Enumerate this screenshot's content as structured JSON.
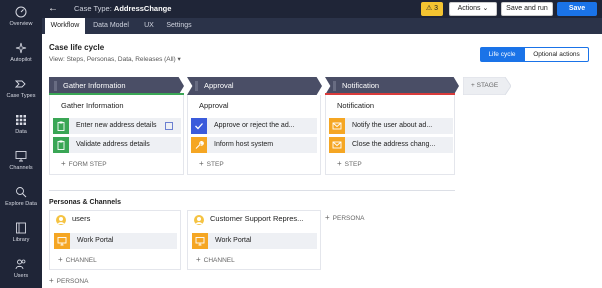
{
  "nav": {
    "items": [
      {
        "label": "Overview",
        "icon": "gauge-icon"
      },
      {
        "label": "Autopilot",
        "icon": "sparkle-icon"
      },
      {
        "label": "Case Types",
        "icon": "chevron-flow-icon"
      },
      {
        "label": "Data",
        "icon": "grid-icon"
      },
      {
        "label": "Channels",
        "icon": "monitor-icon"
      },
      {
        "label": "Explore Data",
        "icon": "explore-icon"
      },
      {
        "label": "Library",
        "icon": "library-icon"
      },
      {
        "label": "Users",
        "icon": "users-icon"
      }
    ]
  },
  "topbar": {
    "case_type_prefix": "Case Type:",
    "case_type_name": "AddressChange",
    "warning_count": "3",
    "actions_label": "Actions",
    "save_and_run_label": "Save and run",
    "save_label": "Save"
  },
  "tabs": [
    {
      "label": "Workflow"
    },
    {
      "label": "Data Model"
    },
    {
      "label": "UX"
    },
    {
      "label": "Settings"
    }
  ],
  "lifecycle": {
    "title": "Case life cycle",
    "view_text": "View: Steps, Personas, Data, Releases (All)",
    "toggle_lifecycle": "Life cycle",
    "toggle_optional": "Optional actions"
  },
  "stages": [
    {
      "name": "Gather Information",
      "accent": "#3aa655",
      "process": "Gather Information",
      "steps": [
        {
          "label": "Enter new address details",
          "icon": "clipboard-icon",
          "color": "#3aa655"
        },
        {
          "label": "Validate address details",
          "icon": "clipboard-icon",
          "color": "#3aa655"
        }
      ],
      "add_label": "FORM STEP"
    },
    {
      "name": "Approval",
      "accent": "#4a4e66",
      "process": "Approval",
      "steps": [
        {
          "label": "Approve or reject the ad...",
          "icon": "check-icon",
          "color": "#3b5bdb"
        },
        {
          "label": "Inform host system",
          "icon": "wrench-icon",
          "color": "#f5a623"
        }
      ],
      "add_label": "STEP"
    },
    {
      "name": "Notification",
      "accent": "#d93b3b",
      "process": "Notification",
      "steps": [
        {
          "label": "Notify the user about ad...",
          "icon": "mail-icon",
          "color": "#f5a623"
        },
        {
          "label": "Close the address chang...",
          "icon": "mail-icon",
          "color": "#f5a623"
        }
      ],
      "add_label": "STEP"
    }
  ],
  "add_stage_label": "STAGE",
  "personas_title": "Personas & Channels",
  "personas": [
    {
      "name": "users",
      "channel": "Work Portal",
      "add_channel": "CHANNEL"
    },
    {
      "name": "Customer Support Repres...",
      "channel": "Work Portal",
      "add_channel": "CHANNEL"
    }
  ],
  "add_persona_label": "PERSONA"
}
